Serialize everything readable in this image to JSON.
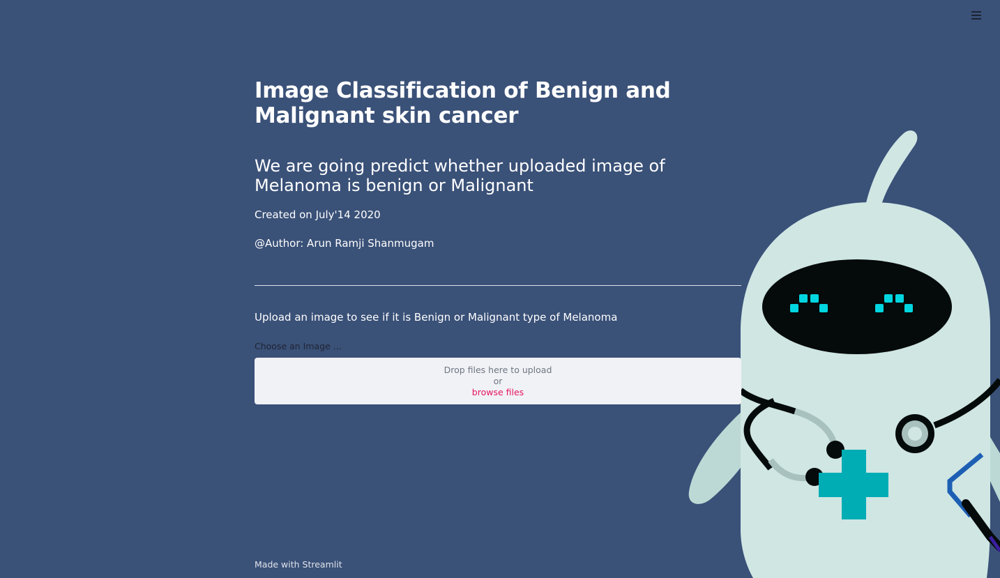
{
  "header": {
    "menu_icon": "hamburger-menu-icon"
  },
  "main": {
    "title": "Image Classification of Benign and Malignant skin cancer",
    "subtitle": "We are going predict whether uploaded image of Melanoma is benign or Malignant",
    "created": "Created on July'14 2020",
    "author": "@Author: Arun Ramji Shanmugam",
    "upload_heading": "Upload an image to see if it is Benign or Malignant type of Melanoma"
  },
  "uploader": {
    "label": "Choose an Image ...",
    "drop_text": "Drop files here to upload",
    "or_text": "or",
    "browse_label": "browse files"
  },
  "footer": {
    "text": "Made with Streamlit"
  },
  "colors": {
    "background": "#3a5178",
    "text": "#ffffff",
    "dropzone_bg": "#f0f2f6",
    "browse_link": "#e8155c",
    "robot_body": "#cfe6e3",
    "robot_visor": "#050a0a",
    "robot_eyes": "#00d6e0",
    "medical_cross": "#00adb5"
  },
  "illustration": {
    "name": "doctor-robot-illustration"
  }
}
